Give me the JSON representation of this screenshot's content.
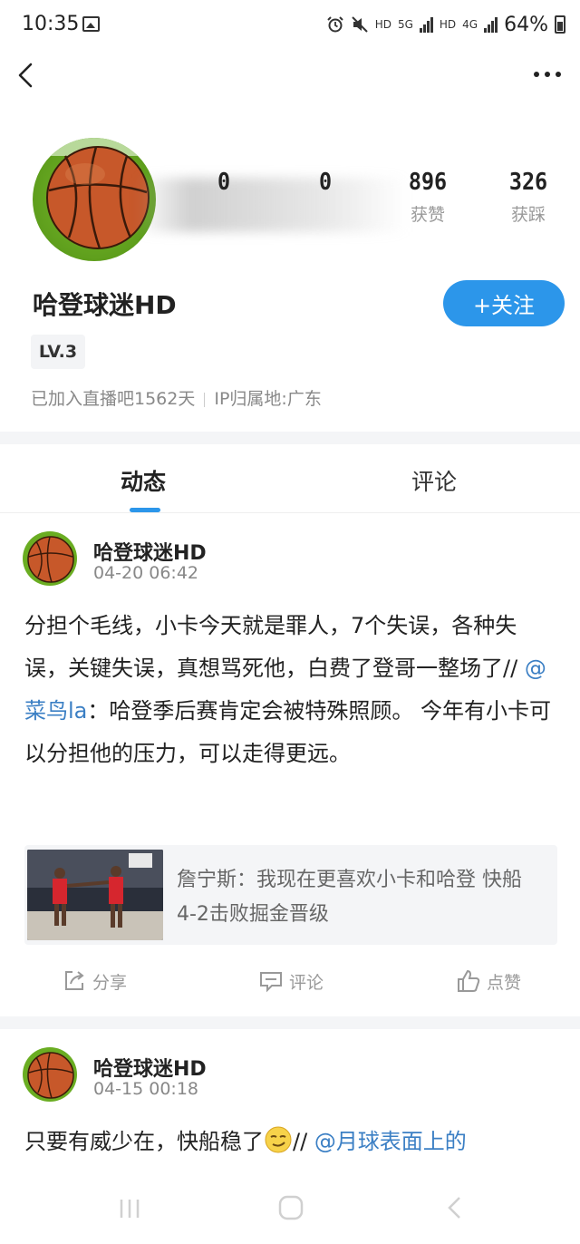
{
  "status_bar": {
    "time": "10:35",
    "indicators": [
      "alarm-icon",
      "mute-icon",
      "HD",
      "5G",
      "HD",
      "4G"
    ],
    "battery": "64%"
  },
  "profile": {
    "name": "哈登球迷HD",
    "level": "LV.3",
    "joined": "已加入直播吧1562天",
    "ip": "IP归属地:广东",
    "follow_label": "+关注",
    "stats": [
      {
        "value": "0",
        "label": ""
      },
      {
        "value": "0",
        "label": ""
      },
      {
        "value": "896",
        "label": "获赞"
      },
      {
        "value": "326",
        "label": "获踩"
      }
    ]
  },
  "tabs": [
    {
      "label": "动态",
      "active": true
    },
    {
      "label": "评论",
      "active": false
    }
  ],
  "posts": [
    {
      "author": "哈登球迷HD",
      "time": "04-20 06:42",
      "text_before": "分担个毛线，小卡今天就是罪人，7个失误，各种失误，关键失误，真想骂死他，白费了登哥一整场了// ",
      "mention": "@菜鸟la",
      "text_after": "：哈登季后赛肯定会被特殊照顾。 今年有小卡可以分担他的压力，可以走得更远。",
      "link_title": "詹宁斯：我现在更喜欢小卡和哈登 快船4-2击败掘金晋级"
    },
    {
      "author": "哈登球迷HD",
      "time": "04-15 00:18",
      "text_before": "只要有威少在，快船稳了",
      "emoji": "smirk-emoji",
      "text_mid": "// ",
      "mention": "@月球表面上的"
    }
  ],
  "actions": {
    "share": "分享",
    "comment": "评论",
    "like": "点赞"
  },
  "colors": {
    "accent": "#2c96ea",
    "mention": "#3b7fc4",
    "muted": "#888888"
  }
}
